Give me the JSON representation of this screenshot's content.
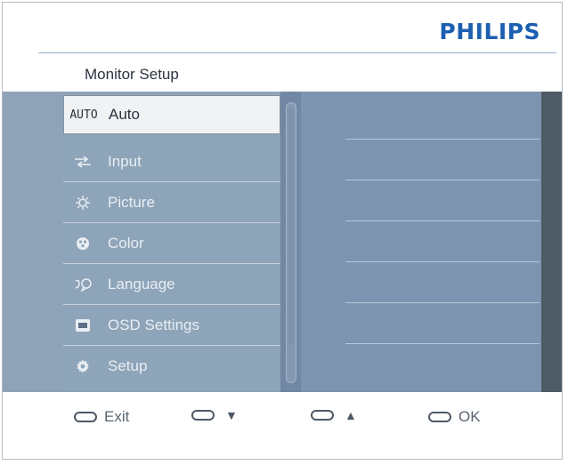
{
  "brand": "PHILIPS",
  "title": "Monitor Setup",
  "menu": [
    {
      "icon_text": "AUTO",
      "icon": "auto-text-icon",
      "label": "Auto",
      "selected": true
    },
    {
      "icon": "input-arrows-icon",
      "label": "Input"
    },
    {
      "icon": "picture-sun-icon",
      "label": "Picture"
    },
    {
      "icon": "color-palette-icon",
      "label": "Color"
    },
    {
      "icon": "language-speech-icon",
      "label": "Language"
    },
    {
      "icon": "osd-screen-icon",
      "label": "OSD Settings"
    },
    {
      "icon": "setup-gear-icon",
      "label": "Setup"
    }
  ],
  "controls": [
    {
      "icon": "pill-button-icon",
      "label": "Exit"
    },
    {
      "icon": "pill-button-icon",
      "label": "",
      "arrow": "▼"
    },
    {
      "icon": "pill-button-icon",
      "label": "",
      "arrow": "▲"
    },
    {
      "icon": "pill-button-icon",
      "label": "OK"
    }
  ],
  "colors": {
    "brand": "#1c5fb0",
    "menu_bg": "#8ea4b9",
    "submenu_bg": "#7d94b0",
    "selected_bg": "#f1f2f4"
  }
}
